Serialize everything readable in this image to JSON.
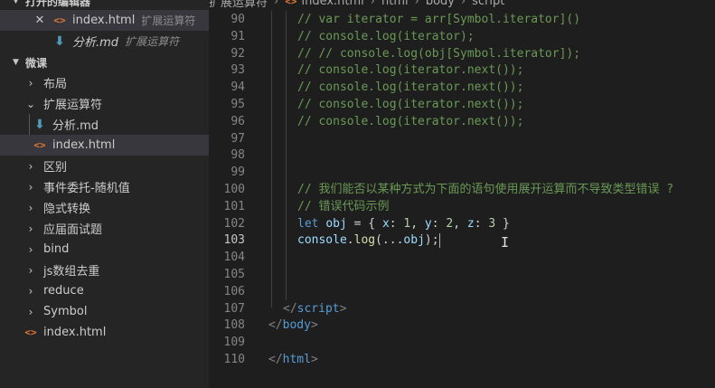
{
  "sidebar": {
    "open_editors_header": "打开的编辑器",
    "open_editors": [
      {
        "name": "index.html",
        "desc": "扩展运算符",
        "icon": "html-file-icon"
      },
      {
        "name": "分析.md",
        "desc": "扩展运算符",
        "icon": "markdown-file-icon"
      }
    ],
    "workspace_header": "微课",
    "tree": [
      {
        "label": "布局",
        "kind": "folder"
      },
      {
        "label": "扩展运算符",
        "kind": "folder-open"
      },
      {
        "label": "分析.md",
        "kind": "md"
      },
      {
        "label": "index.html",
        "kind": "html"
      },
      {
        "label": "区别",
        "kind": "folder"
      },
      {
        "label": "事件委托-随机值",
        "kind": "folder"
      },
      {
        "label": "隐式转换",
        "kind": "folder"
      },
      {
        "label": "应届面试题",
        "kind": "folder"
      },
      {
        "label": "bind",
        "kind": "folder"
      },
      {
        "label": "js数组去重",
        "kind": "folder"
      },
      {
        "label": "reduce",
        "kind": "folder"
      },
      {
        "label": "Symbol",
        "kind": "folder"
      },
      {
        "label": "index.html",
        "kind": "html"
      }
    ]
  },
  "breadcrumb": [
    "扩展运算符",
    "index.html",
    "html",
    "body",
    "script"
  ],
  "editor": {
    "current_line": "103",
    "lines": [
      {
        "n": "90",
        "tokens": [
          {
            "c": "cm",
            "t": "// var iterator = arr[Symbol.iterator]()"
          }
        ]
      },
      {
        "n": "91",
        "tokens": [
          {
            "c": "cm",
            "t": "// console.log(iterator);"
          }
        ]
      },
      {
        "n": "92",
        "tokens": [
          {
            "c": "cm",
            "t": "// // console.log(obj[Symbol.iterator]);"
          }
        ]
      },
      {
        "n": "93",
        "tokens": [
          {
            "c": "cm",
            "t": "// console.log(iterator.next());"
          }
        ]
      },
      {
        "n": "94",
        "tokens": [
          {
            "c": "cm",
            "t": "// console.log(iterator.next());"
          }
        ]
      },
      {
        "n": "95",
        "tokens": [
          {
            "c": "cm",
            "t": "// console.log(iterator.next());"
          }
        ]
      },
      {
        "n": "96",
        "tokens": [
          {
            "c": "cm",
            "t": "// console.log(iterator.next());"
          }
        ]
      },
      {
        "n": "97",
        "tokens": []
      },
      {
        "n": "98",
        "tokens": []
      },
      {
        "n": "99",
        "tokens": []
      },
      {
        "n": "100",
        "tokens": [
          {
            "c": "cm",
            "t": "// 我们能否以某种方式为下面的语句使用展开运算而不导致类型错误 ?"
          }
        ]
      },
      {
        "n": "101",
        "tokens": [
          {
            "c": "cm",
            "t": "// 错误代码示例"
          }
        ]
      },
      {
        "n": "102",
        "tokens": [
          {
            "c": "kw",
            "t": "let"
          },
          {
            "c": "txt",
            "t": " "
          },
          {
            "c": "var",
            "t": "obj"
          },
          {
            "c": "txt",
            "t": " = "
          },
          {
            "c": "brace",
            "t": "{"
          },
          {
            "c": "txt",
            "t": " "
          },
          {
            "c": "var",
            "t": "x"
          },
          {
            "c": "txt",
            "t": ": "
          },
          {
            "c": "num",
            "t": "1"
          },
          {
            "c": "txt",
            "t": ", "
          },
          {
            "c": "var",
            "t": "y"
          },
          {
            "c": "txt",
            "t": ": "
          },
          {
            "c": "num",
            "t": "2"
          },
          {
            "c": "txt",
            "t": ", "
          },
          {
            "c": "var",
            "t": "z"
          },
          {
            "c": "txt",
            "t": ": "
          },
          {
            "c": "num",
            "t": "3"
          },
          {
            "c": "txt",
            "t": " "
          },
          {
            "c": "brace",
            "t": "}"
          }
        ]
      },
      {
        "n": "103",
        "tokens": [
          {
            "c": "var",
            "t": "console"
          },
          {
            "c": "txt",
            "t": "."
          },
          {
            "c": "fn",
            "t": "log"
          },
          {
            "c": "txt",
            "t": "(..."
          },
          {
            "c": "var",
            "t": "obj"
          },
          {
            "c": "txt",
            "t": ");"
          }
        ]
      },
      {
        "n": "104",
        "tokens": []
      },
      {
        "n": "105",
        "tokens": []
      },
      {
        "n": "106",
        "tokens": []
      },
      {
        "n": "107",
        "tokens": [
          {
            "c": "tagbr",
            "t": "</"
          },
          {
            "c": "tag",
            "t": "script"
          },
          {
            "c": "tagbr",
            "t": ">"
          }
        ]
      },
      {
        "n": "108",
        "tokens": [
          {
            "c": "tagbr",
            "t": "</"
          },
          {
            "c": "tag",
            "t": "body"
          },
          {
            "c": "tagbr",
            "t": ">"
          }
        ]
      },
      {
        "n": "109",
        "tokens": []
      },
      {
        "n": "110",
        "tokens": [
          {
            "c": "tagbr",
            "t": "</"
          },
          {
            "c": "tag",
            "t": "html"
          },
          {
            "c": "tagbr",
            "t": ">"
          }
        ]
      }
    ]
  }
}
